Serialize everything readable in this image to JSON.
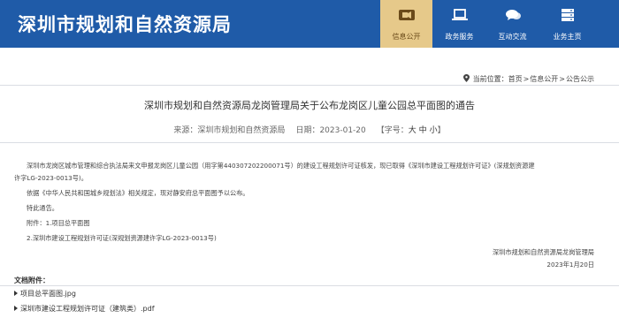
{
  "site": {
    "title": "深圳市规划和自然资源局"
  },
  "nav": [
    {
      "label": "信息公开",
      "icon": "video-icon",
      "active": true
    },
    {
      "label": "政务服务",
      "icon": "laptop-icon",
      "active": false
    },
    {
      "label": "互动交流",
      "icon": "chat-bubbles-icon",
      "active": false
    },
    {
      "label": "业务主页",
      "icon": "server-icon",
      "active": false
    }
  ],
  "breadcrumb": {
    "prefix": "当前位置：",
    "items": [
      "首页",
      "信息公开",
      "公告公示"
    ],
    "separator": ">"
  },
  "article": {
    "title": "深圳市规划和自然资源局龙岗管理局关于公布龙岗区儿童公园总平面图的通告",
    "source_label": "来源：",
    "source": "深圳市规划和自然资源局",
    "date_label": "日期：",
    "date": "2023-01-20",
    "font_open": "【字号：",
    "font_large": "大",
    "font_medium": "中",
    "font_small": "小",
    "font_close": "】",
    "paragraphs": [
      "深圳市龙岗区城市管理和综合执法局来文申报龙岗区儿童公园（用字第440307202200071号）的建设工程规划许可证核发，现已取得《深圳市建设工程规划许可证》(深规划资源建",
      "许字LG-2023-0013号)。",
      "依据《中华人民共和国城乡规划法》相关规定，现对静安府总平面图予以公布。",
      "特此通告。",
      "附件：1.项目总平面图",
      "2.深圳市建设工程规划许可证(深规划资源建许字LG-2023-0013号)"
    ],
    "signature": "深圳市规划和自然资源局龙岗管理局",
    "sign_date": "2023年1月20日"
  },
  "attachments": {
    "title": "文档附件：",
    "items": [
      "项目总平面图.jpg",
      "深圳市建设工程规划许可证（建筑类）.pdf"
    ]
  }
}
